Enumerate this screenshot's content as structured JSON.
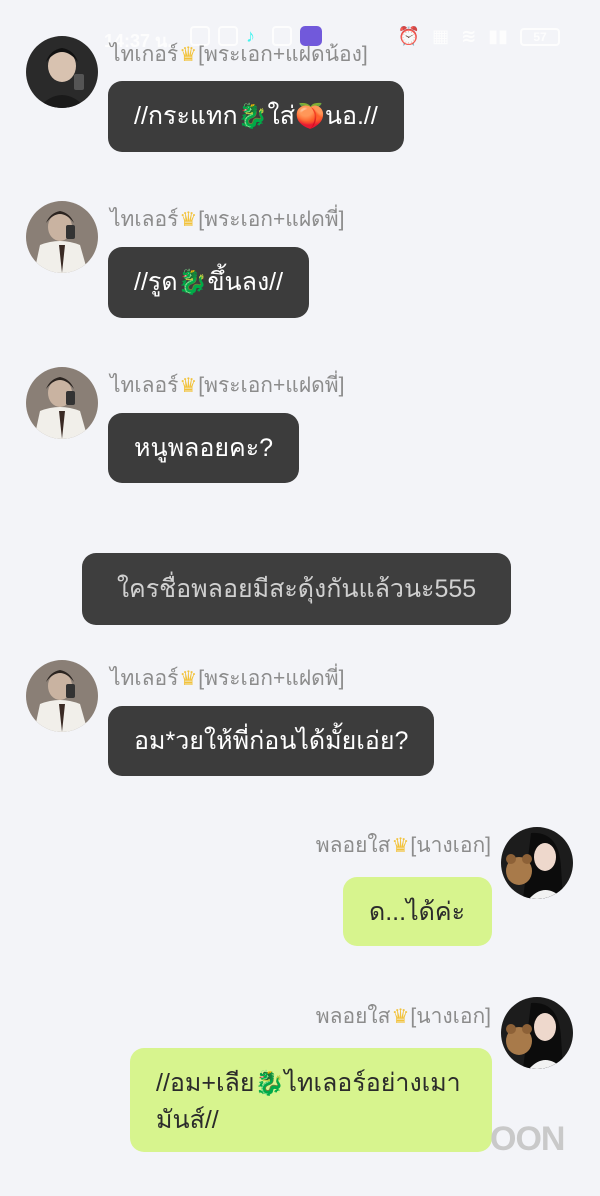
{
  "status_bar": {
    "time": "14:37 น.",
    "battery": "57"
  },
  "messages": [
    {
      "sender": "ไทเกอร์",
      "role": "[พระเอก+แฝดน้อง]",
      "text_before": "//กระแทก",
      "emoji1": "🐉",
      "text_mid": "ใส่",
      "emoji2": "🍑",
      "text_after": "นอ.//"
    },
    {
      "sender": "ไทเลอร์",
      "role": "[พระเอก+แฝดพี่]",
      "text_before": "//รูด",
      "emoji1": "🐉",
      "text_after": "ขึ้นลง//"
    },
    {
      "sender": "ไทเลอร์",
      "role": "[พระเอก+แฝดพี่]",
      "text": "หนูพลอยคะ?"
    },
    {
      "sender": "ไทเลอร์",
      "role": "[พระเอก+แฝดพี่]",
      "text": "อม*วยให้พี่ก่อนได้มั้ยเอ่ย?"
    },
    {
      "sender": "พลอยใส",
      "role": "[นางเอก]",
      "text": "ด...ได้ค่ะ"
    },
    {
      "sender": "พลอยใส",
      "role": "[นางเอก]",
      "text_before": "//อม+เลีย",
      "emoji1": "🐉",
      "text_after": "ไทเลอร์อย่างเมามันส์//"
    }
  ],
  "narration": "ใครชื่อพลอยมีสะดุ้งกันแล้วนะ555",
  "crown_glyph": "♛",
  "watermark": "OON",
  "colors": {
    "background": "#f3f4f8",
    "dark_bubble": "#3c3c3c",
    "light_bubble": "#d7f48e",
    "crown": "#f2c23a"
  }
}
